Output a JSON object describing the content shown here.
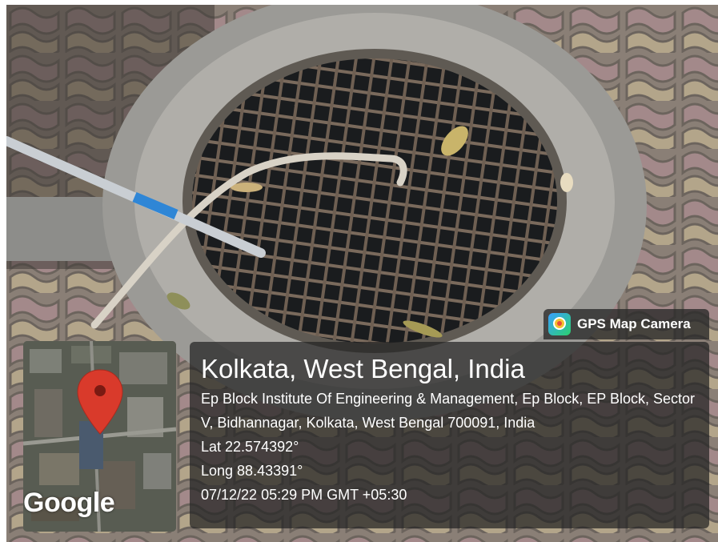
{
  "overlay": {
    "app_label": "GPS Map Camera",
    "app_icon": "gps-map-camera-icon",
    "map_brand": "Google",
    "pin_icon": "map-pin-icon",
    "title": "Kolkata, West Bengal, India",
    "address": "Ep Block Institute Of Engineering & Management, Ep Block, EP Block, Sector V, Bidhannagar, Kolkata, West Bengal 700091, India",
    "lat": "Lat 22.574392°",
    "long": "Long 88.43391°",
    "datetime": "07/12/22 05:29 PM GMT +05:30"
  },
  "colors": {
    "pin": "#d93a2b",
    "panel_bg": "rgba(35,35,35,0.72)",
    "text": "#ffffff"
  }
}
